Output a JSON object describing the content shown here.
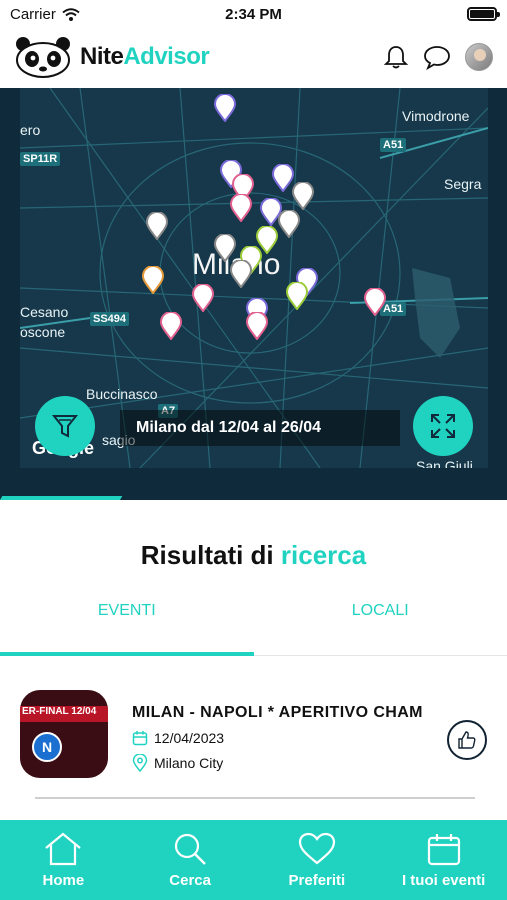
{
  "status_bar": {
    "carrier": "Carrier",
    "time": "2:34 PM"
  },
  "header": {
    "brand_part1": "Nite",
    "brand_part2": "Advisor",
    "icons": [
      "bell-icon",
      "chat-icon",
      "avatar"
    ]
  },
  "map": {
    "labels": {
      "ero": "ero",
      "vimodrone": "Vimodrone",
      "segra": "Segra",
      "cesano": "Cesano",
      "boscone": "oscone",
      "buccinasco": "Buccinasco",
      "sangiuli": "San Giuli",
      "sagio": "sagio"
    },
    "badges": {
      "sp11r": "SP11R",
      "a51_top": "A51",
      "a51_right": "A51",
      "ss494": "SS494",
      "a7": "A7"
    },
    "city": "Milano",
    "caption": "Milano dal 12/04 al 26/04",
    "attribution": "Google"
  },
  "results": {
    "title_main": "Risultati di",
    "title_highlight": "ricerca",
    "tabs": [
      {
        "label": "EVENTI",
        "active": true
      },
      {
        "label": "LOCALI",
        "active": false
      }
    ]
  },
  "events": [
    {
      "title": "MILAN - NAPOLI * APERITIVO CHAM",
      "date": "12/04/2023",
      "location": "Milano City",
      "thumb_banner": "ER-FINAL  12/04",
      "thumb_crest": "N"
    }
  ],
  "bottom_nav": [
    {
      "label": "Home",
      "icon": "home-icon"
    },
    {
      "label": "Cerca",
      "icon": "search-icon"
    },
    {
      "label": "Preferiti",
      "icon": "heart-icon"
    },
    {
      "label": "I tuoi eventi",
      "icon": "calendar-icon"
    }
  ],
  "colors": {
    "accent": "#20d3c1",
    "map_bg": "#16384a"
  }
}
